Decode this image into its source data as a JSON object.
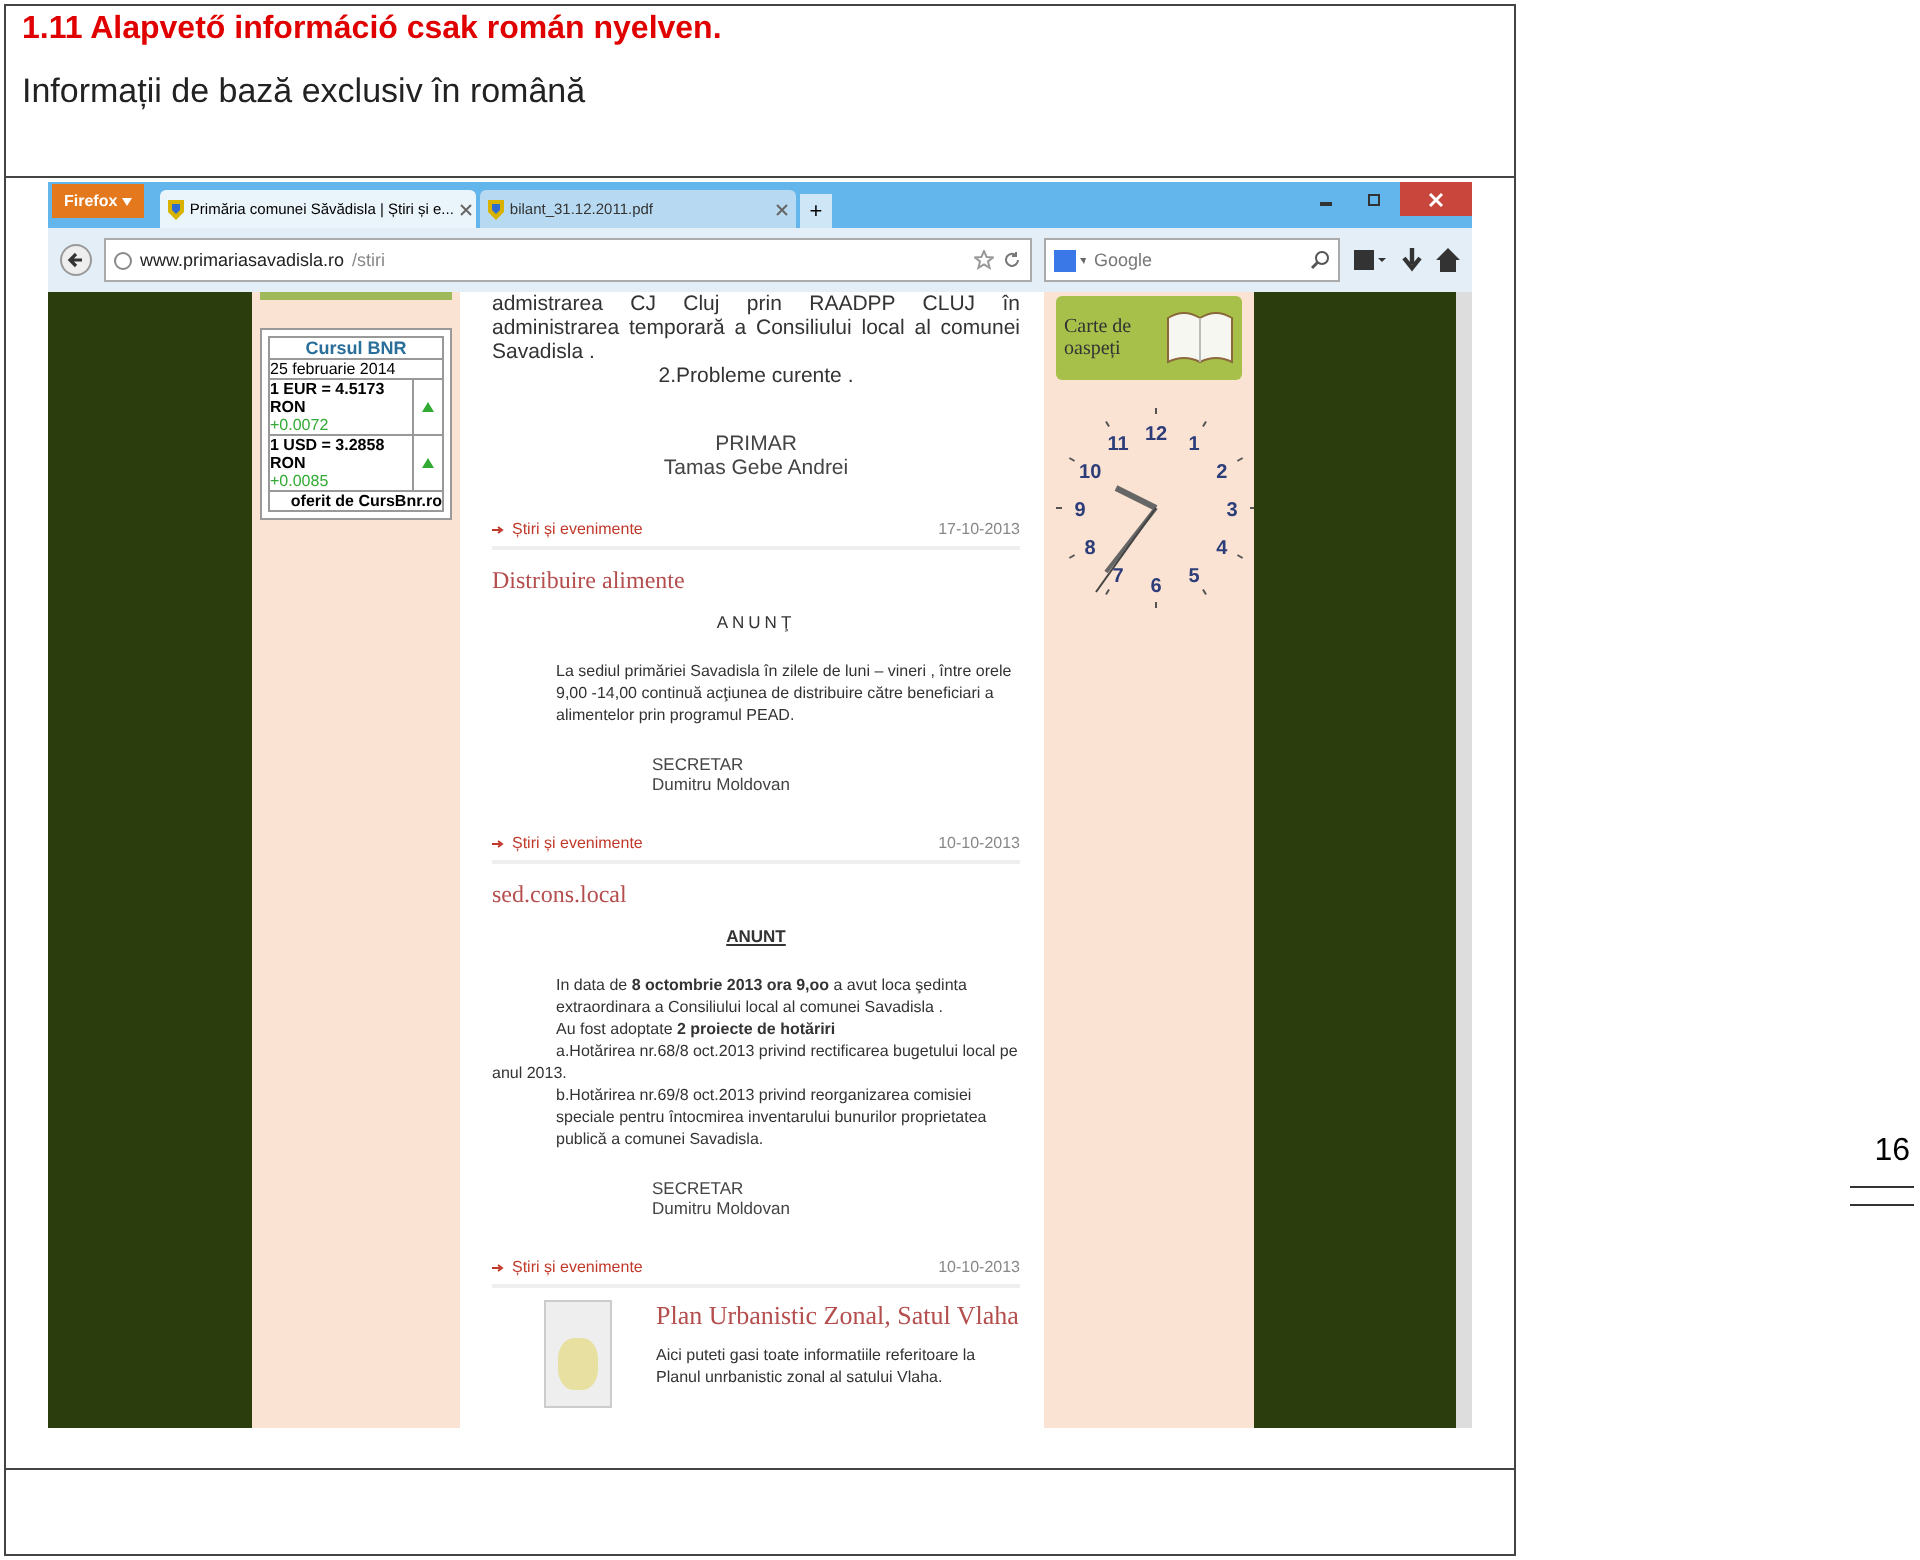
{
  "document": {
    "heading": "1.11 Alapvető információ csak román nyelven.",
    "subtitle": "Informații de bază exclusiv în română",
    "page_number": "16"
  },
  "browser": {
    "menu_button": "Firefox",
    "tabs": [
      {
        "label": "Primăria comunei Săvădisla | Știri și e...",
        "selected": true
      },
      {
        "label": "bilant_31.12.2011.pdf",
        "selected": false
      }
    ],
    "new_tab": "+",
    "url_domain": "www.primariasavadisla.ro",
    "url_path": "/stiri",
    "search_placeholder": "Google"
  },
  "exchange_widget": {
    "title": "Cursul BNR",
    "date": "25 februarie 2014",
    "rates": [
      {
        "rate": "1 EUR = 4.5173 RON",
        "change": "+0.0072"
      },
      {
        "rate": "1 USD = 3.2858 RON",
        "change": "+0.0085"
      }
    ],
    "credit": "oferit de CursBnr.ro"
  },
  "intro": {
    "text": "admistrarea CJ Cluj prin RAADPP CLUJ în administrarea temporară a Consiliului local al comunei Savadisla .",
    "item": "2.Probleme curente .",
    "signature": [
      "PRIMAR",
      "Tamas Gebe Andrei"
    ]
  },
  "posts": [
    {
      "kind": "text",
      "category": "Știri și evenimente",
      "date": "17-10-2013",
      "title": "Distribuire alimente",
      "heading": {
        "text": "ANUNŢ",
        "underlined": false
      },
      "paragraphs": [
        {
          "text": "La sediul primăriei Savadisla în zilele de luni – vineri , între orele 9,00 -14,00 continuă acţiunea de distribuire către beneficiari a alimentelor prin programul PEAD.",
          "kind": "indented"
        }
      ],
      "signature": [
        "SECRETAR",
        "Dumitru Moldovan"
      ]
    },
    {
      "kind": "text",
      "category": "Știri și evenimente",
      "date": "10-10-2013",
      "title": "sed.cons.local",
      "heading": {
        "text": "ANUNT",
        "underlined": true
      },
      "paragraphs": [
        {
          "text": "In data de **8 octombrie 2013 ora 9,oo** a avut loca şedinta extraordinara a Consiliului local al comunei Savadisla .",
          "kind": "indented"
        },
        {
          "text": "Au fost adoptate **2 proiecte de hotăriri**",
          "kind": "indented"
        },
        {
          "text": "a.Hotărirea nr.68/8 oct.2013 privind rectificarea bugetului local pe anul 2013.",
          "kind": "hanging"
        },
        {
          "text": "b.Hotărirea nr.69/8 oct.2013 privind reorganizarea comisiei speciale pentru întocmirea inventarului bunurilor proprietatea publică a comunei Savadisla.",
          "kind": "indented"
        }
      ],
      "signature": [
        "SECRETAR",
        "Dumitru Moldovan"
      ]
    },
    {
      "kind": "thumb",
      "category": "Știri și evenimente",
      "date": "10-10-2013",
      "title": "Plan Urbanistic Zonal, Satul Vlaha",
      "paragraphs": [
        {
          "text": "Aici puteti gasi toate informatiile referitoare la Planul unrbanistic zonal al satului Vlaha.",
          "kind": "plain"
        }
      ]
    }
  ],
  "guestbook": {
    "label": "Carte de oaspeți"
  },
  "clock": {
    "numbers": [
      "12",
      "1",
      "2",
      "3",
      "4",
      "5",
      "6",
      "7",
      "8",
      "9",
      "10",
      "11"
    ]
  }
}
